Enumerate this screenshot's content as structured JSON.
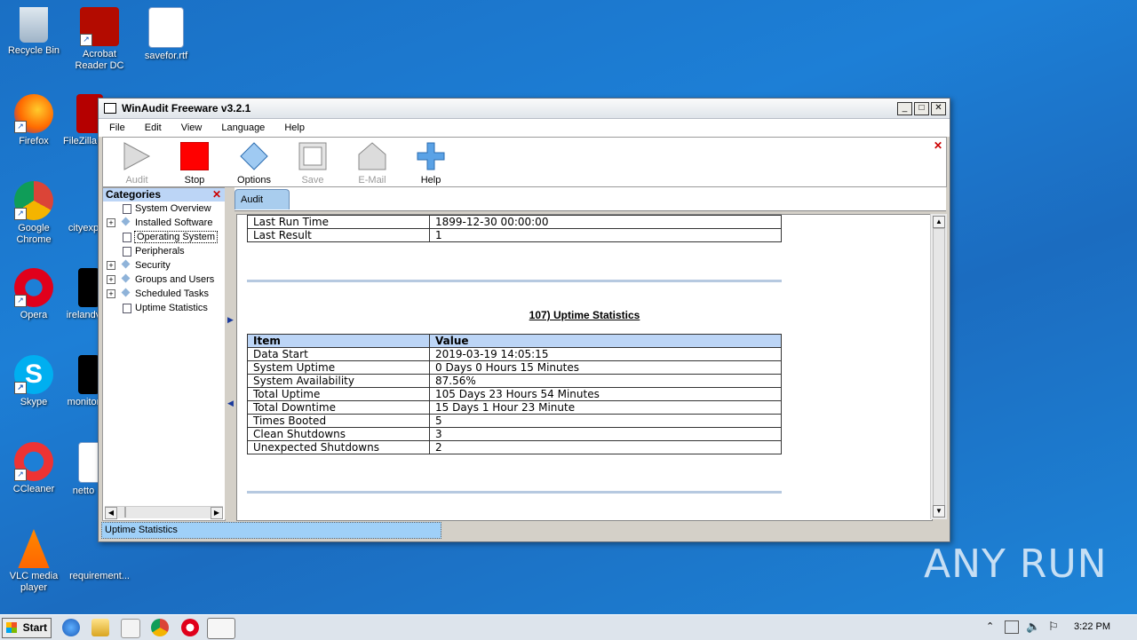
{
  "desktop": {
    "icons": [
      {
        "label": "Recycle Bin"
      },
      {
        "label": "Acrobat Reader DC"
      },
      {
        "label": "savefor.rtf"
      },
      {
        "label": "Firefox"
      },
      {
        "label": "FileZilla"
      },
      {
        "label": "Google Chrome"
      },
      {
        "label": "cityexp"
      },
      {
        "label": "Opera"
      },
      {
        "label": "irelandv"
      },
      {
        "label": "Skype"
      },
      {
        "label": "monitor"
      },
      {
        "label": "CCleaner"
      },
      {
        "label": "netto"
      },
      {
        "label": "VLC media player"
      },
      {
        "label": "requirement..."
      }
    ],
    "watermark": "ANY RUN"
  },
  "window": {
    "title": "WinAudit Freeware v3.2.1",
    "menu": [
      "File",
      "Edit",
      "View",
      "Language",
      "Help"
    ],
    "toolbar": [
      {
        "label": "Audit",
        "icon": "play-icon",
        "enabled": false
      },
      {
        "label": "Stop",
        "icon": "stop-icon",
        "enabled": true
      },
      {
        "label": "Options",
        "icon": "diamond-icon",
        "enabled": true
      },
      {
        "label": "Save",
        "icon": "save-icon",
        "enabled": false
      },
      {
        "label": "E-Mail",
        "icon": "house-icon",
        "enabled": false
      },
      {
        "label": "Help",
        "icon": "plus-icon",
        "enabled": true
      }
    ],
    "categories": {
      "title": "Categories",
      "items": [
        {
          "label": "System Overview",
          "expandable": false,
          "selected": false
        },
        {
          "label": "Installed Software",
          "expandable": true,
          "selected": false
        },
        {
          "label": "Operating System",
          "expandable": false,
          "selected": true
        },
        {
          "label": "Peripherals",
          "expandable": false,
          "selected": false
        },
        {
          "label": "Security",
          "expandable": true,
          "selected": false
        },
        {
          "label": "Groups and Users",
          "expandable": true,
          "selected": false
        },
        {
          "label": "Scheduled Tasks",
          "expandable": true,
          "selected": false
        },
        {
          "label": "Uptime Statistics",
          "expandable": false,
          "selected": false
        }
      ]
    },
    "tab": "Audit",
    "top_table": [
      {
        "item": "Last Run Time",
        "value": "1899-12-30 00:00:00"
      },
      {
        "item": "Last Result",
        "value": "1"
      }
    ],
    "section_title": "107) Uptime Statistics",
    "uptime_table": {
      "headers": {
        "item": "Item",
        "value": "Value"
      },
      "rows": [
        {
          "item": "Data Start",
          "value": "2019-03-19 14:05:15"
        },
        {
          "item": "System Uptime",
          "value": "0 Days 0 Hours 15 Minutes"
        },
        {
          "item": "System Availability",
          "value": "87.56%"
        },
        {
          "item": "Total Uptime",
          "value": "105 Days 23 Hours 54 Minutes"
        },
        {
          "item": "Total Downtime",
          "value": "15 Days 1 Hour 23 Minute"
        },
        {
          "item": "Times Booted",
          "value": "5"
        },
        {
          "item": "Clean Shutdowns",
          "value": "3"
        },
        {
          "item": "Unexpected Shutdowns",
          "value": "2"
        }
      ]
    },
    "status": "Uptime Statistics"
  },
  "taskbar": {
    "start": "Start",
    "clock": "3:22 PM"
  }
}
